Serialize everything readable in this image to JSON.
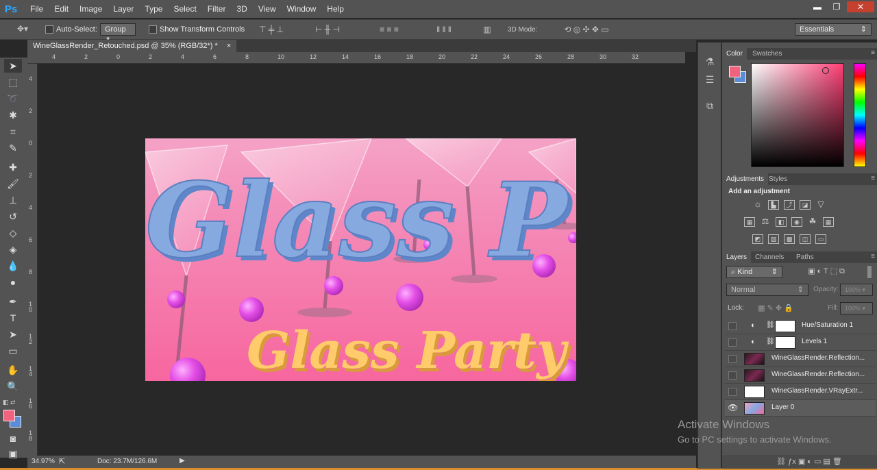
{
  "app": {
    "logo": "Ps"
  },
  "menu": [
    "File",
    "Edit",
    "Image",
    "Layer",
    "Type",
    "Select",
    "Filter",
    "3D",
    "View",
    "Window",
    "Help"
  ],
  "window": {
    "min": "▬",
    "restore": "❐",
    "close": "✕"
  },
  "options": {
    "auto_select": "Auto-Select:",
    "group": "Group",
    "transform": "Show Transform Controls",
    "mode3d": "3D Mode:",
    "workspace": "Essentials"
  },
  "document": {
    "tab": "WineGlassRender_Retouched.psd @ 35% (RGB/32*) *",
    "close": "×",
    "zoom": "34.97%",
    "doc": "Doc: 23.7M/126.6M"
  },
  "ruler": {
    "h": [
      "4",
      "2",
      "0",
      "2",
      "4",
      "6",
      "8",
      "10",
      "12",
      "14",
      "16",
      "18",
      "20",
      "22",
      "24",
      "26",
      "28",
      "30",
      "32"
    ],
    "v": [
      "4",
      "2",
      "0",
      "2",
      "4",
      "6",
      "8",
      "1\n0",
      "1\n2",
      "1\n4",
      "1\n6",
      "1\n8"
    ]
  },
  "artwork": {
    "title1": "Glass P",
    "title2": "Glass Party"
  },
  "panels": {
    "color_tabs": [
      "Color",
      "Swatches"
    ],
    "adj_tabs": [
      "Adjustments",
      "Styles"
    ],
    "adj_title": "Add an adjustment",
    "layer_tabs": [
      "Layers",
      "Channels",
      "Paths"
    ],
    "kind": "Kind",
    "blend": "Normal",
    "opacity_label": "Opacity:",
    "opacity_val": "100%",
    "lock_label": "Lock:",
    "fill_label": "Fill:",
    "fill_val": "100%",
    "layers": [
      "Hue/Saturation 1",
      "Levels 1",
      "WineGlassRender.Reflection...",
      "WineGlassRender.Reflection...",
      "WineGlassRender.VRayExtr...",
      "Layer 0"
    ]
  },
  "colors": {
    "fg": "#f0637f",
    "bg": "#5b8dd6",
    "accent": "#31a8ff"
  },
  "watermark": {
    "line1": "Activate Windows",
    "line2": "Go to PC settings to activate Windows."
  }
}
